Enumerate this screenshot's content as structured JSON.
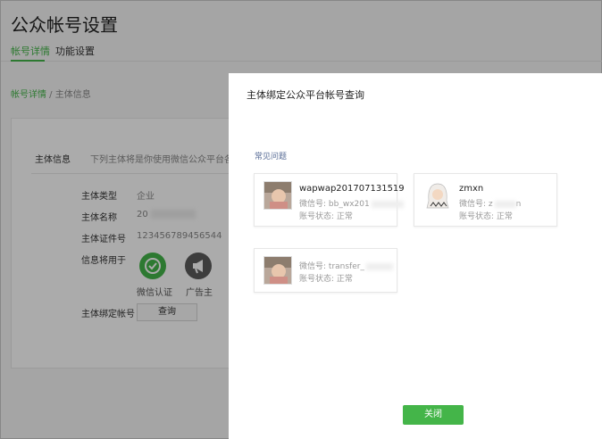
{
  "page": {
    "title": "公众帐号设置",
    "tabs": [
      {
        "label": "帐号详情",
        "active": true
      },
      {
        "label": "功能设置",
        "active": false
      }
    ],
    "breadcrumb": {
      "link": "帐号详情",
      "separator": " / ",
      "current": "主体信息"
    }
  },
  "card": {
    "head_title": "主体信息",
    "head_desc": "下列主体将是你使用微信公众平台各项服务",
    "rows": [
      {
        "label": "主体类型",
        "value": "企业"
      },
      {
        "label": "主体名称",
        "value": "20"
      },
      {
        "label": "主体证件号",
        "value": "123456789456544"
      },
      {
        "label": "信息将用于",
        "value": ""
      }
    ],
    "uses": [
      {
        "label": "微信认证",
        "icon": "check-circle-icon",
        "color": "#44b549"
      },
      {
        "label": "广告主",
        "icon": "megaphone-icon",
        "color": "#5b5b5b"
      }
    ],
    "bind_label": "主体绑定帐号",
    "query_button": "查询"
  },
  "modal": {
    "title": "主体绑定公众平台帐号查询",
    "faq": "常见问题",
    "accounts": [
      {
        "name": "wapwap201707131519",
        "wechat_label": "微信号:",
        "wechat_id": "bb_wx201",
        "status_label": "账号状态:",
        "status": "正常"
      },
      {
        "name": "zmxn",
        "wechat_label": "微信号:",
        "wechat_id": "z",
        "wechat_suffix": "n",
        "status_label": "账号状态:",
        "status": "正常"
      },
      {
        "name": "",
        "wechat_label": "微信号:",
        "wechat_id": "transfer_",
        "status_label": "账号状态:",
        "status": "正常"
      }
    ],
    "close_button": "关闭"
  },
  "colors": {
    "accent": "#44b549",
    "link": "#576b95"
  }
}
